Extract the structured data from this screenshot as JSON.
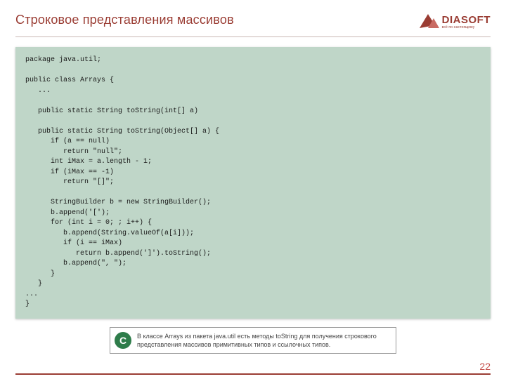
{
  "header": {
    "title": "Строковое представления массивов",
    "logo": {
      "brand": "DIASOFT",
      "tagline": "всё по-настоящему"
    }
  },
  "code": "package java.util;\n\npublic class Arrays {\n   ...\n\n   public static String toString(int[] a)\n\n   public static String toString(Object[] a) {\n      if (a == null)\n         return \"null\";\n      int iMax = a.length - 1;\n      if (iMax == -1)\n         return \"[]\";\n\n      StringBuilder b = new StringBuilder();\n      b.append('[');\n      for (int i = 0; ; i++) {\n         b.append(String.valueOf(a[i]));\n         if (i == iMax)\n            return b.append(']').toString();\n         b.append(\", \");\n      }\n   }\n...\n}",
  "callout": {
    "badge": "C",
    "text": "В классе Arrays из пакета java.util есть методы toString для получения строкового представления массивов примитивных типов и ссылочных типов."
  },
  "page_number": "22"
}
